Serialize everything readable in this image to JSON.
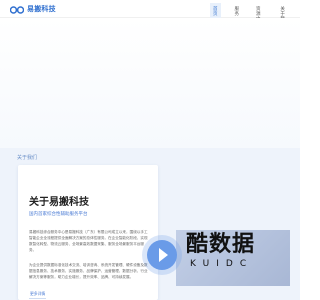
{
  "header": {
    "logo_text": "易搬科技",
    "nav": [
      "首页",
      "服务",
      "资源中心",
      "关于我"
    ]
  },
  "about": {
    "section_tag": "关于我们",
    "title": "关于易搬科技",
    "subtitle": "国内首家综合性辅助服务平台",
    "paragraph1": "易搬科技综合服务中心是易搬科技（广东）有限公司成立以来，围绕以手工智能企业全流程提供全面解决方案的总体性服务。在企业智能化阶段，实现数智化转型、物流云服务、全场景高效数据采集、服务全场景服务平台服务。",
    "paragraph2": "为企业提供数据标准化技术交流、培训咨询、系统开发管理、硬件设备及数据信息服务、技术服务、实施服务、品牌保护、运营管理、数据分析、行业解决方案等服务，助力企业增长，提升效率、品牌、可持续发展。",
    "more_label": "更多详情"
  },
  "watermark": {
    "main": "酷数据",
    "sub": "KUIDC"
  },
  "colors": {
    "brand": "#2f6fcf",
    "about_bg": "#eef3fb",
    "play": "#6a9be8"
  }
}
